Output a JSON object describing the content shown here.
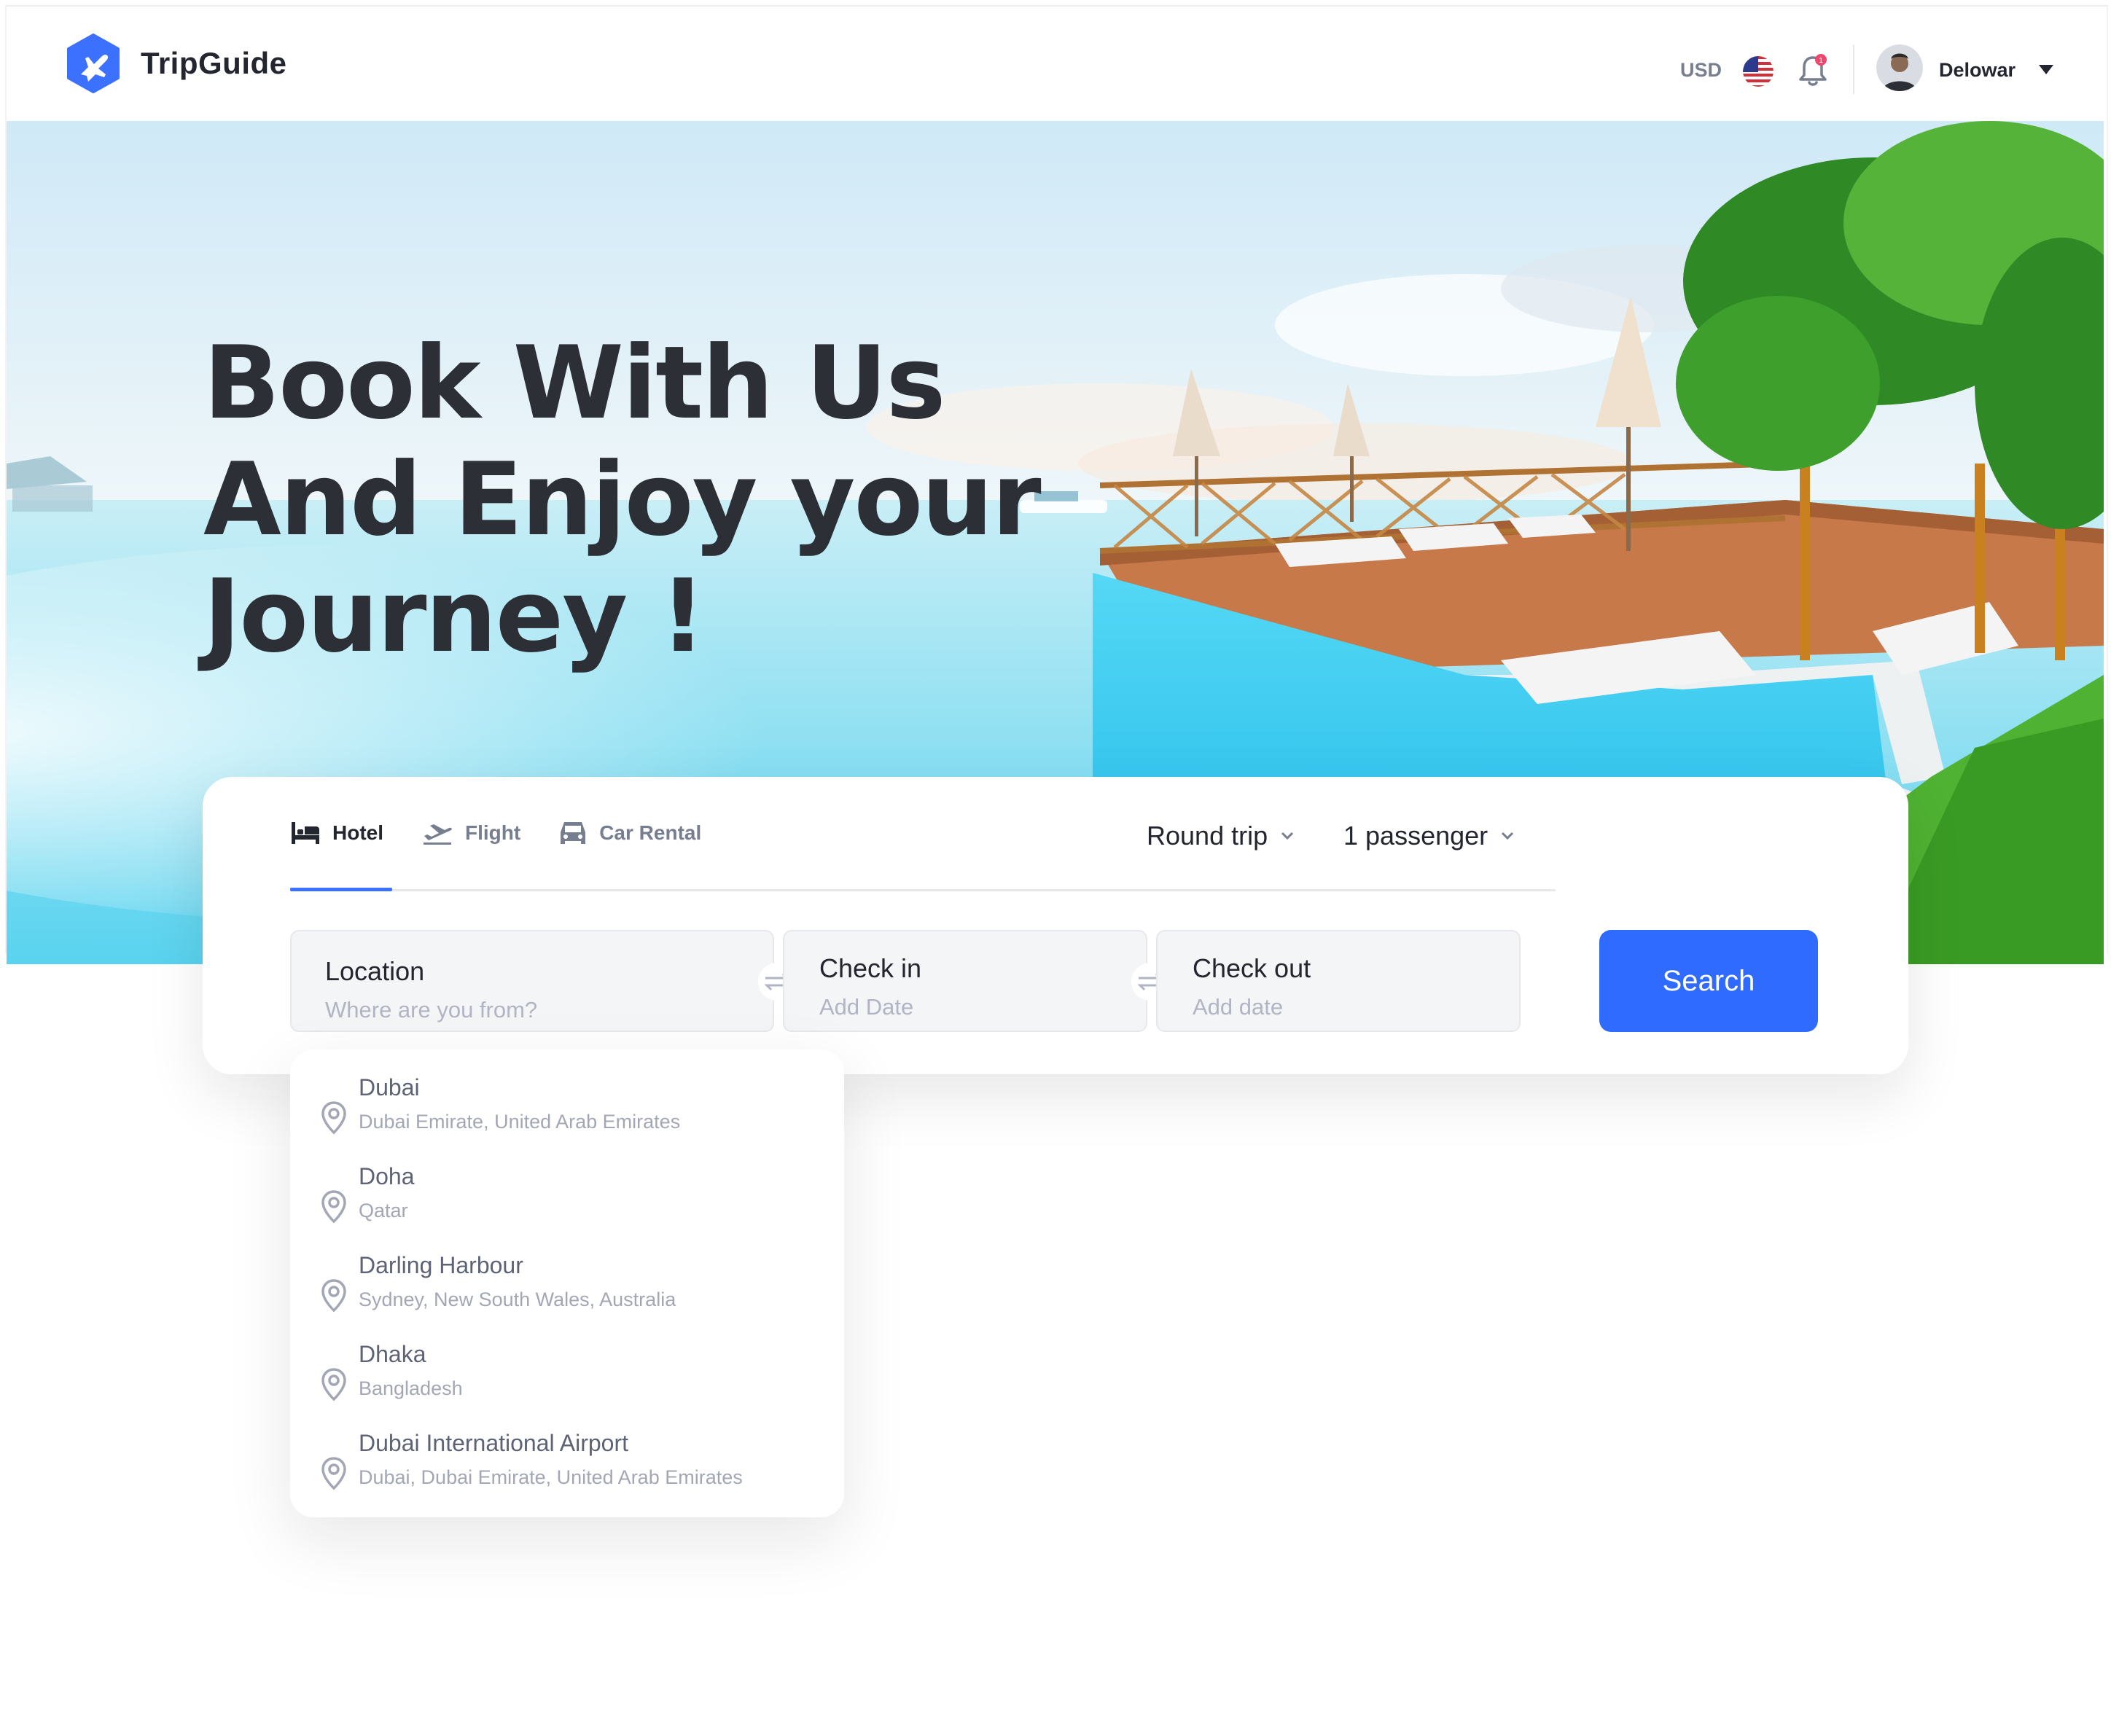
{
  "header": {
    "brand": "TripGuide",
    "currency": "USD",
    "user_name": "Delowar",
    "notification_count": "1"
  },
  "hero": {
    "headline_lines": [
      "Book With Us",
      "And Enjoy your",
      "Journey !"
    ]
  },
  "search": {
    "tabs": [
      {
        "label": "Hotel",
        "icon": "bed-icon",
        "active": true
      },
      {
        "label": "Flight",
        "icon": "plane-takeoff-icon",
        "active": false
      },
      {
        "label": "Car Rental",
        "icon": "car-icon",
        "active": false
      }
    ],
    "trip_type": "Round trip",
    "passengers": "1 passenger",
    "location": {
      "label": "Location",
      "placeholder": "Where are you from?"
    },
    "check_in": {
      "label": "Check in",
      "placeholder": "Add Date"
    },
    "check_out": {
      "label": "Check out",
      "placeholder": "Add date"
    },
    "search_label": "Search"
  },
  "suggestions": [
    {
      "name": "Dubai",
      "detail": "Dubai Emirate, United Arab Emirates"
    },
    {
      "name": "Doha",
      "detail": "Qatar"
    },
    {
      "name": "Darling Harbour",
      "detail": "Sydney, New South Wales, Australia"
    },
    {
      "name": "Dhaka",
      "detail": "Bangladesh"
    },
    {
      "name": "Dubai International Airport",
      "detail": "Dubai, Dubai Emirate, United Arab Emirates"
    }
  ],
  "colors": {
    "accent": "#3B71FE",
    "search_button": "#2F6BFF",
    "text_primary": "#23262F",
    "text_muted": "#777E90",
    "notification_dot": "#EF466F"
  }
}
